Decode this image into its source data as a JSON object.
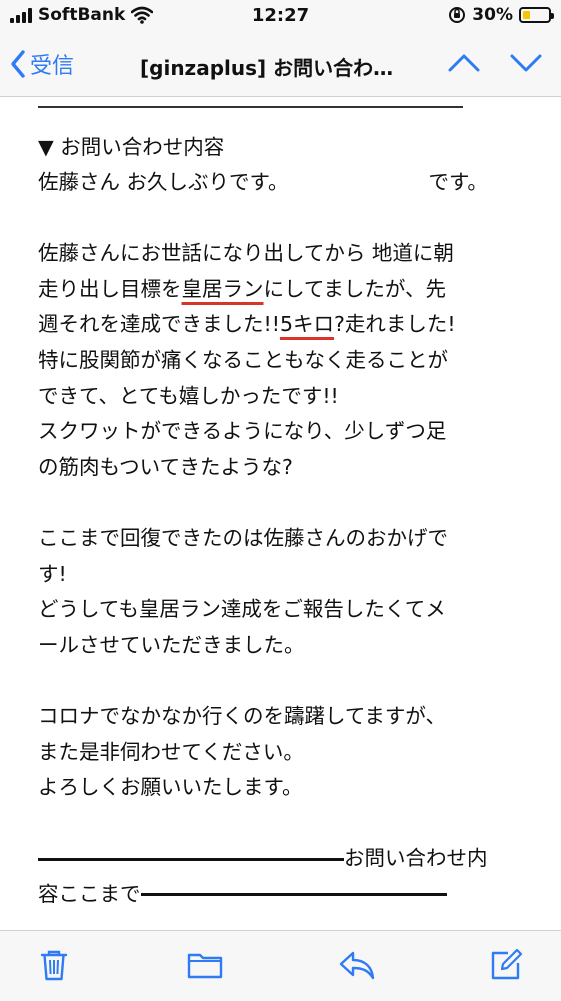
{
  "status_bar": {
    "carrier": "SoftBank",
    "time": "12:27",
    "battery": "30%",
    "battery_level": 0.3
  },
  "nav": {
    "back_label": "受信",
    "subject": "[ginzaplus] お問い合わ…"
  },
  "mail": {
    "section_heading": "▼ お問い合わせ内容",
    "greeting_a": "佐藤さん お久しぶりです。",
    "greeting_b": "です。",
    "p1": {
      "l1": "佐藤さんにお世話になり出してから 地道に朝",
      "l2a": "走り出し目標を",
      "l2_hl": "皇居ラン",
      "l2b": "にしてましたが、先",
      "l3a": "週それを達成できました!!",
      "l3_hl": "5キロ",
      "l3b": "?走れました!",
      "l4": "特に股関節が痛くなることもなく走ることが",
      "l5": "できて、とても嬉しかったです!!",
      "l6": "スクワットができるようになり、少しずつ足",
      "l7": "の筋肉もついてきたような?"
    },
    "p2": {
      "l1": "ここまで回復できたのは佐藤さんのおかげで",
      "l2": "す!",
      "l3": "どうしても皇居ラン達成をご報告したくてメ",
      "l4": "ールさせていただきました。"
    },
    "p3": {
      "l1": "コロナでなかなか行くのを躊躇してますが、",
      "l2": "また是非伺わせてください。",
      "l3": "よろしくお願いいたします。"
    },
    "footer_a": "お問い合わせ内",
    "footer_b": "容ここまで"
  },
  "colors": {
    "accent": "#2f7bf6",
    "highlight_underline": "#d8342a",
    "battery_fill": "#f5c600"
  },
  "toolbar": {
    "icons": [
      "trash-icon",
      "folder-icon",
      "reply-icon",
      "compose-icon"
    ]
  }
}
